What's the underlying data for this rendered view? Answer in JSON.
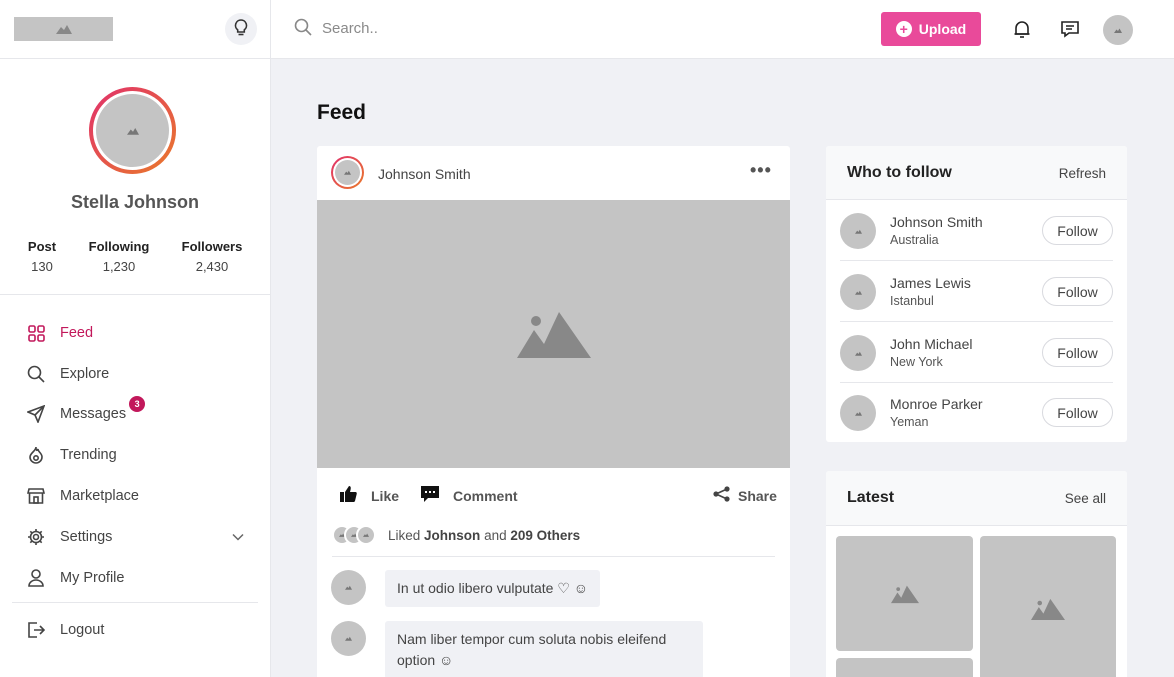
{
  "header": {
    "search_placeholder": "Search..",
    "upload_label": "Upload"
  },
  "profile": {
    "name": "Stella Johnson",
    "stats": [
      {
        "label": "Post",
        "value": "130"
      },
      {
        "label": "Following",
        "value": "1,230"
      },
      {
        "label": "Followers",
        "value": "2,430"
      }
    ]
  },
  "nav": {
    "items": [
      {
        "label": "Feed",
        "icon": "grid-icon",
        "active": true
      },
      {
        "label": "Explore",
        "icon": "search-icon"
      },
      {
        "label": "Messages",
        "icon": "send-icon",
        "badge": "3"
      },
      {
        "label": "Trending",
        "icon": "flame-icon"
      },
      {
        "label": "Marketplace",
        "icon": "store-icon"
      },
      {
        "label": "Settings",
        "icon": "gear-icon"
      },
      {
        "label": "My Profile",
        "icon": "user-icon"
      }
    ],
    "logout": "Logout"
  },
  "main": {
    "title": "Feed",
    "post": {
      "author": "Johnson Smith",
      "actions": {
        "like": "Like",
        "comment": "Comment",
        "share": "Share"
      },
      "liked": {
        "prefix": "Liked",
        "name": "Johnson",
        "middle": "and",
        "others": "209 Others"
      },
      "comments": [
        {
          "line1": "In ut odio libero vulputate ♡ ☺"
        },
        {
          "line1": "Nam liber tempor cum soluta nobis eleifend",
          "line2": "option ☺"
        }
      ]
    }
  },
  "who_to_follow": {
    "title": "Who to follow",
    "refresh": "Refresh",
    "follow_label": "Follow",
    "people": [
      {
        "name": "Johnson Smith",
        "location": "Australia"
      },
      {
        "name": "James Lewis",
        "location": "Istanbul"
      },
      {
        "name": "John Michael",
        "location": "New York"
      },
      {
        "name": "Monroe Parker",
        "location": "Yeman"
      }
    ]
  },
  "latest": {
    "title": "Latest",
    "see_all": "See all"
  },
  "colors": {
    "accent": "#e94a9a",
    "active_nav": "#c2185b",
    "background": "#f0f1f5"
  }
}
